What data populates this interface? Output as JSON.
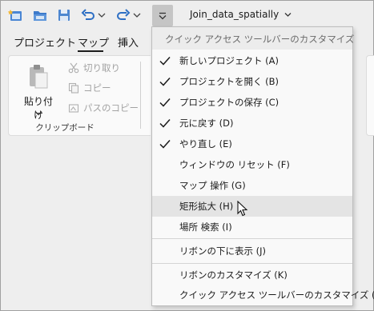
{
  "window": {
    "title": "Join_data_spatially"
  },
  "tabs": [
    {
      "label": "プロジェクト",
      "active": false
    },
    {
      "label": "マップ",
      "active": true
    },
    {
      "label": "挿入",
      "active": false
    }
  ],
  "ribbon": {
    "paste_label": "貼り付け",
    "cut_label": "切り取り",
    "copy_label": "コピー",
    "copy_path_label": "パスのコピー",
    "group_label": "クリップボード"
  },
  "menu": {
    "header": "クイック アクセス ツールバーのカスタマイズ",
    "items": [
      {
        "label": "新しいプロジェクト (A)",
        "checked": true
      },
      {
        "label": "プロジェクトを開く (B)",
        "checked": true
      },
      {
        "label": "プロジェクトの保存 (C)",
        "checked": true
      },
      {
        "label": "元に戻す (D)",
        "checked": true
      },
      {
        "label": "やり直し (E)",
        "checked": true
      },
      {
        "label": "ウィンドウの リセット (F)",
        "checked": false
      },
      {
        "label": "マップ 操作 (G)",
        "checked": false
      },
      {
        "label": "矩形拡大 (H)",
        "checked": false,
        "hovered": true
      },
      {
        "label": "場所 検索 (I)",
        "checked": false
      },
      {
        "label": "リボンの下に表示 (J)",
        "checked": false
      },
      {
        "label": "リボンのカスタマイズ (K)",
        "checked": false
      },
      {
        "label": "クイック アクセス ツールバーのカスタマイズ (L)",
        "checked": false
      }
    ]
  },
  "icons": {
    "new_project": "new-project-icon",
    "open_project": "open-folder-icon",
    "save_project": "save-icon",
    "undo": "undo-icon",
    "redo": "redo-icon",
    "customize": "chevron-down-icon"
  },
  "colors": {
    "accent_blue": "#2d6fc4",
    "folder_yellow": "#e8a93a",
    "hover_bg": "#e4e4e4"
  }
}
